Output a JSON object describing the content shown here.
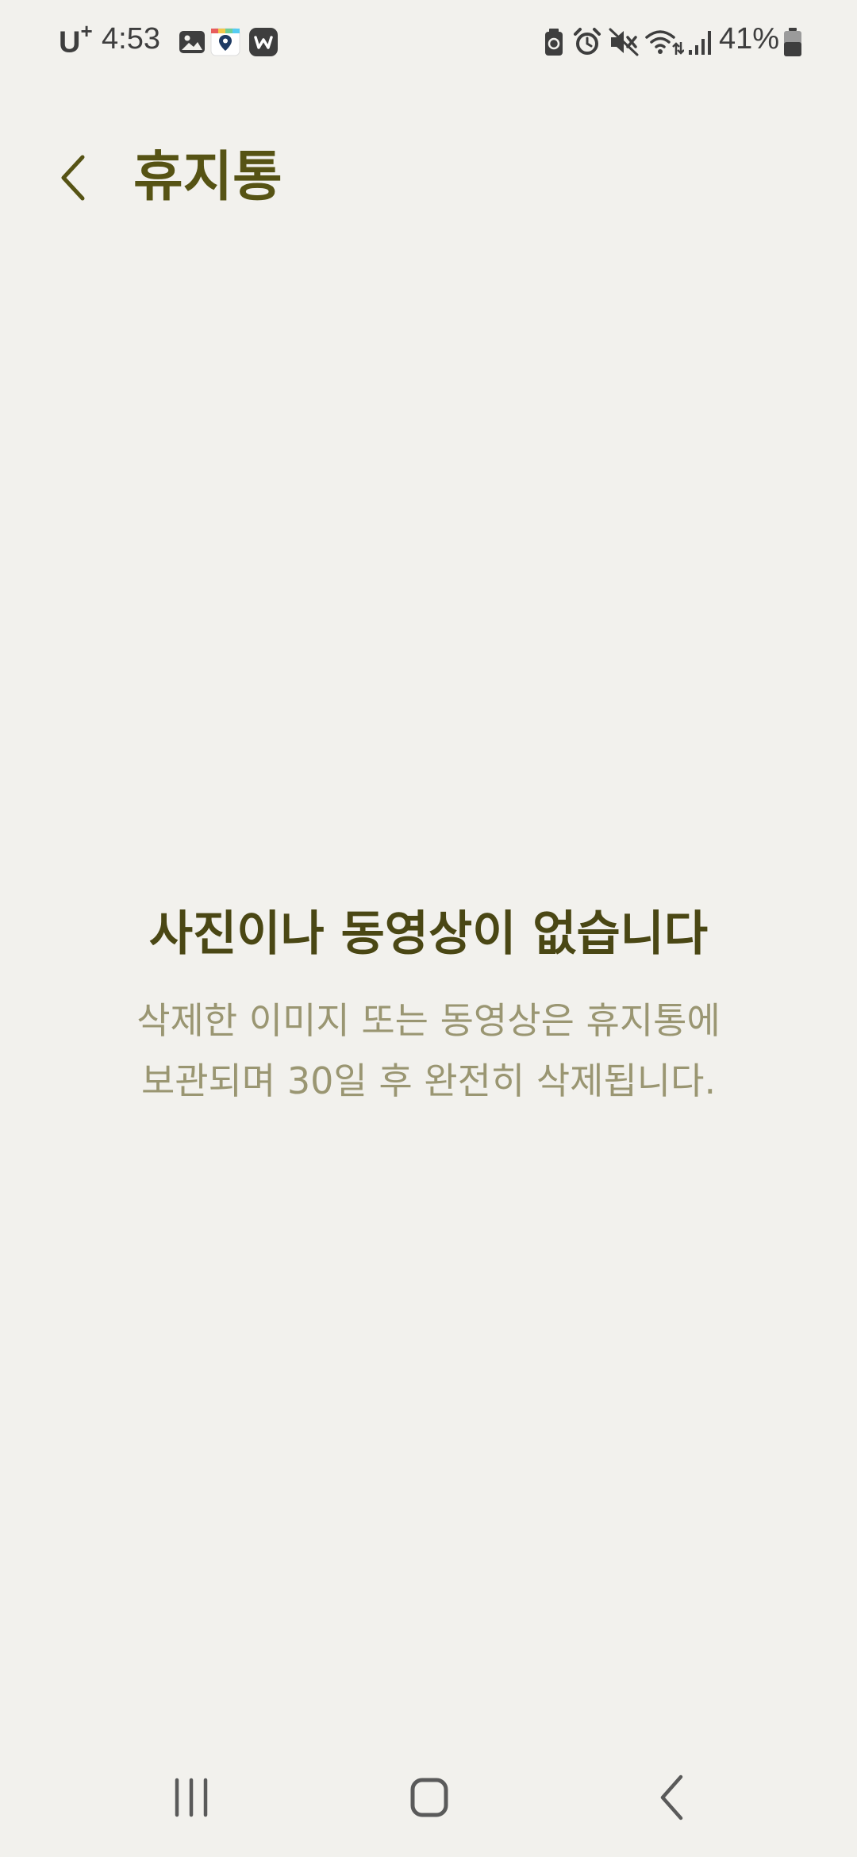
{
  "status_bar": {
    "carrier": "U",
    "carrier_sup": "+",
    "time": "4:53",
    "battery_percent": "41%",
    "icons": [
      "gallery-icon",
      "map-pin-app-icon",
      "w-app-icon",
      "battery-saver-icon",
      "alarm-icon",
      "mute-icon",
      "wifi-icon",
      "signal-icon",
      "battery-icon"
    ]
  },
  "header": {
    "title": "휴지통"
  },
  "empty_state": {
    "title": "사진이나 동영상이 없습니다",
    "description_line1": "삭제한 이미지 또는 동영상은 휴지통에",
    "description_line2": "보관되며 30일 후 완전히 삭제됩니다."
  },
  "nav_bar": {
    "buttons": [
      "recent-apps",
      "home",
      "back"
    ]
  },
  "colors": {
    "background": "#f2f1ed",
    "title": "#565314",
    "empty_title": "#4a4714",
    "description": "#9a9672",
    "status_text": "#3e3e3e"
  }
}
